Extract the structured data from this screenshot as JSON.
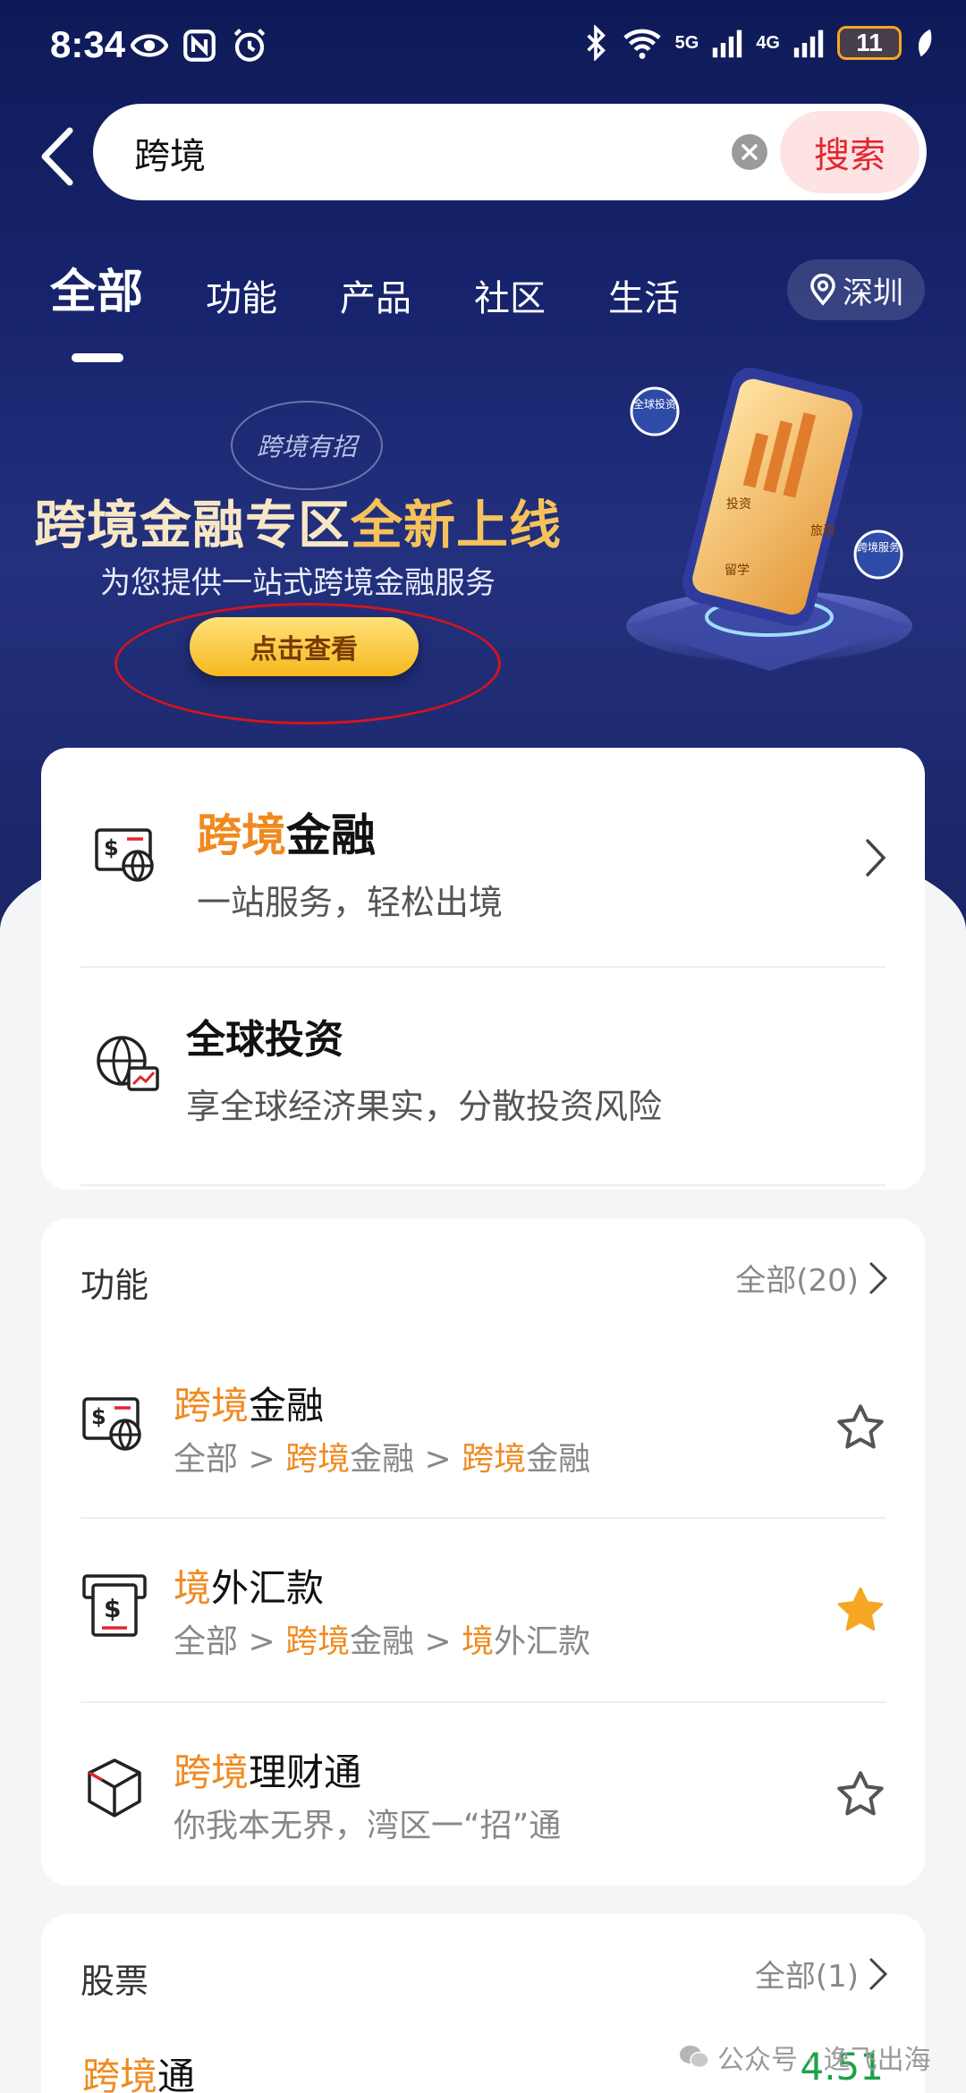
{
  "status_bar": {
    "time": "8:34",
    "network_1": "5G",
    "network_2": "4G",
    "battery": "11"
  },
  "search": {
    "query": "跨境",
    "button_label": "搜索"
  },
  "tabs": [
    {
      "label": "全部",
      "active": true
    },
    {
      "label": "功能",
      "active": false
    },
    {
      "label": "产品",
      "active": false
    },
    {
      "label": "社区",
      "active": false
    },
    {
      "label": "生活",
      "active": false
    }
  ],
  "location": "深圳",
  "banner": {
    "seal_text": "跨境有招",
    "title_part1": "跨境金融专区",
    "title_part2": "全新上线",
    "subtitle": "为您提供一站式跨境金融服务",
    "cta_label": "点击查看",
    "art_labels": {
      "global_invest": "全球投资",
      "invest": "投资",
      "travel": "旅游",
      "study": "留学",
      "cross_border_service": "跨境服务"
    }
  },
  "featured": {
    "item1": {
      "title_highlight": "跨境",
      "title_rest": "金融",
      "subtitle": "一站服务，轻松出境",
      "icon": "cross-border-finance-icon"
    },
    "item2": {
      "title": "全球投资",
      "subtitle": "享全球经济果实，分散投资风险",
      "icon": "global-invest-icon"
    }
  },
  "functions": {
    "title": "功能",
    "more_label": "全部(20)",
    "items": [
      {
        "title_highlight": "跨境",
        "title_rest": "金融",
        "path": {
          "p1": "全部 > ",
          "h1": "跨境",
          "p2": "金融 > ",
          "h2": "跨境",
          "p3": "金融"
        },
        "starred": false,
        "icon": "cross-border-finance-icon"
      },
      {
        "title_highlight": "境",
        "title_rest": "外汇款",
        "path": {
          "p1": "全部 > ",
          "h1": "跨境",
          "p2": "金融 > ",
          "h2": "境",
          "p3": "外汇款"
        },
        "starred": true,
        "icon": "remittance-icon"
      },
      {
        "title_highlight": "跨境",
        "title_rest": "理财通",
        "subtitle": "你我本无界，湾区一“招”通",
        "starred": false,
        "icon": "wealth-connect-icon"
      }
    ]
  },
  "stocks": {
    "title": "股票",
    "more_label": "全部(1)",
    "item": {
      "name_highlight": "跨境",
      "name_rest": "通",
      "value": "4.51"
    }
  },
  "watermark": "公众号 · 逸飞出海",
  "colors": {
    "highlight": "#f08a1f",
    "brand_red": "#e3262f",
    "star_gold": "#f5a623",
    "hero_navy": "#16236b"
  }
}
